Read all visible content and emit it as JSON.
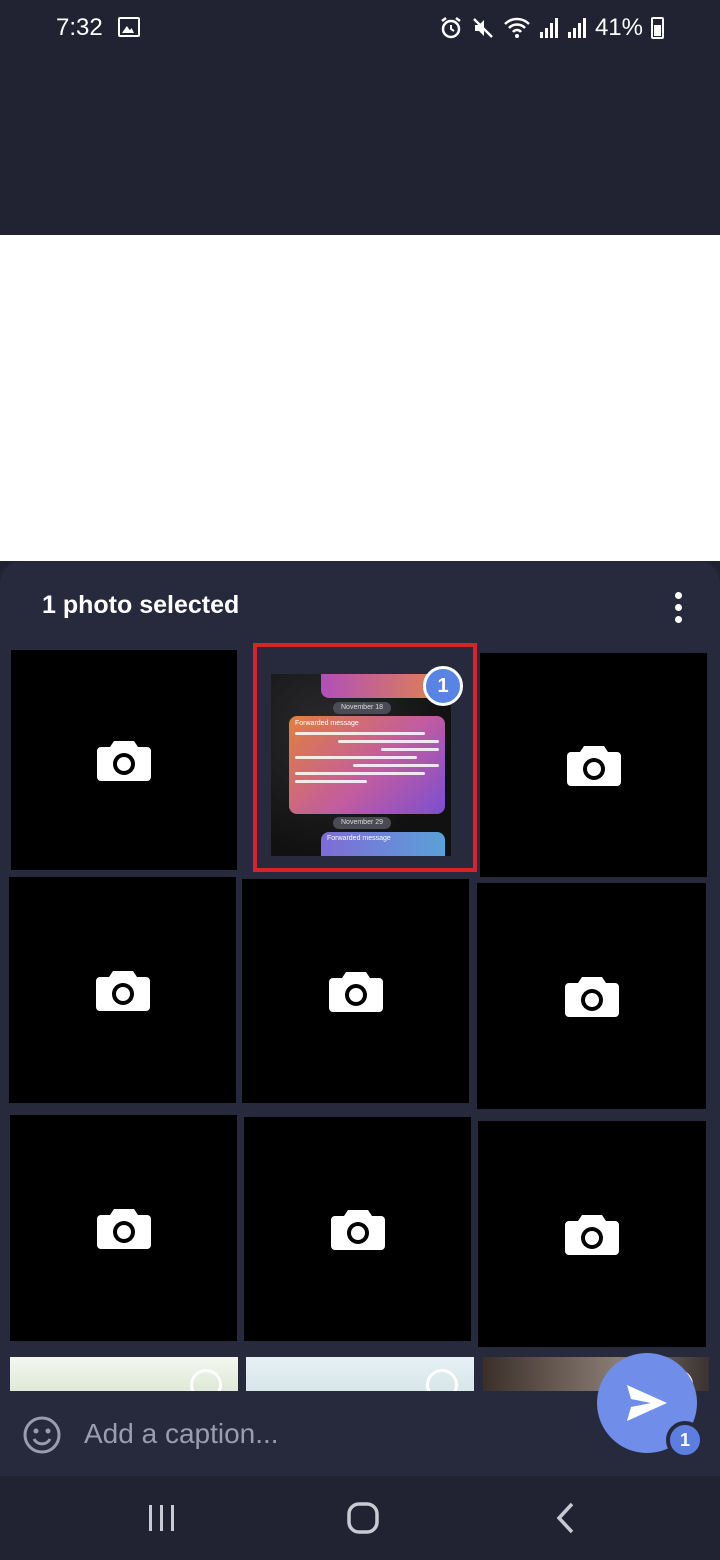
{
  "status_bar": {
    "time": "7:32",
    "battery_text": "41%",
    "icons": [
      "gallery-icon",
      "alarm-icon",
      "mute-icon",
      "wifi-icon",
      "signal-icon",
      "signal-icon",
      "battery-icon"
    ]
  },
  "sheet": {
    "title": "1 photo selected",
    "more_icon": "more-vertical-icon"
  },
  "grid": {
    "selected_index": 2,
    "selected_count": "1",
    "tile_icon": "camera-icon",
    "preview": {
      "date_1": "November 18",
      "forwarded_label": "Forwarded message",
      "date_2": "November 29"
    }
  },
  "caption": {
    "placeholder": "Add a caption...",
    "emoji_icon": "emoji-icon"
  },
  "send": {
    "icon": "send-icon",
    "count": "1"
  },
  "nav_bar": {
    "buttons": [
      "recents-icon",
      "home-icon",
      "back-icon"
    ]
  },
  "colors": {
    "background": "#212332",
    "sheet": "#272a3c",
    "accent": "#6f8de9",
    "selection_border": "#d6242b"
  }
}
